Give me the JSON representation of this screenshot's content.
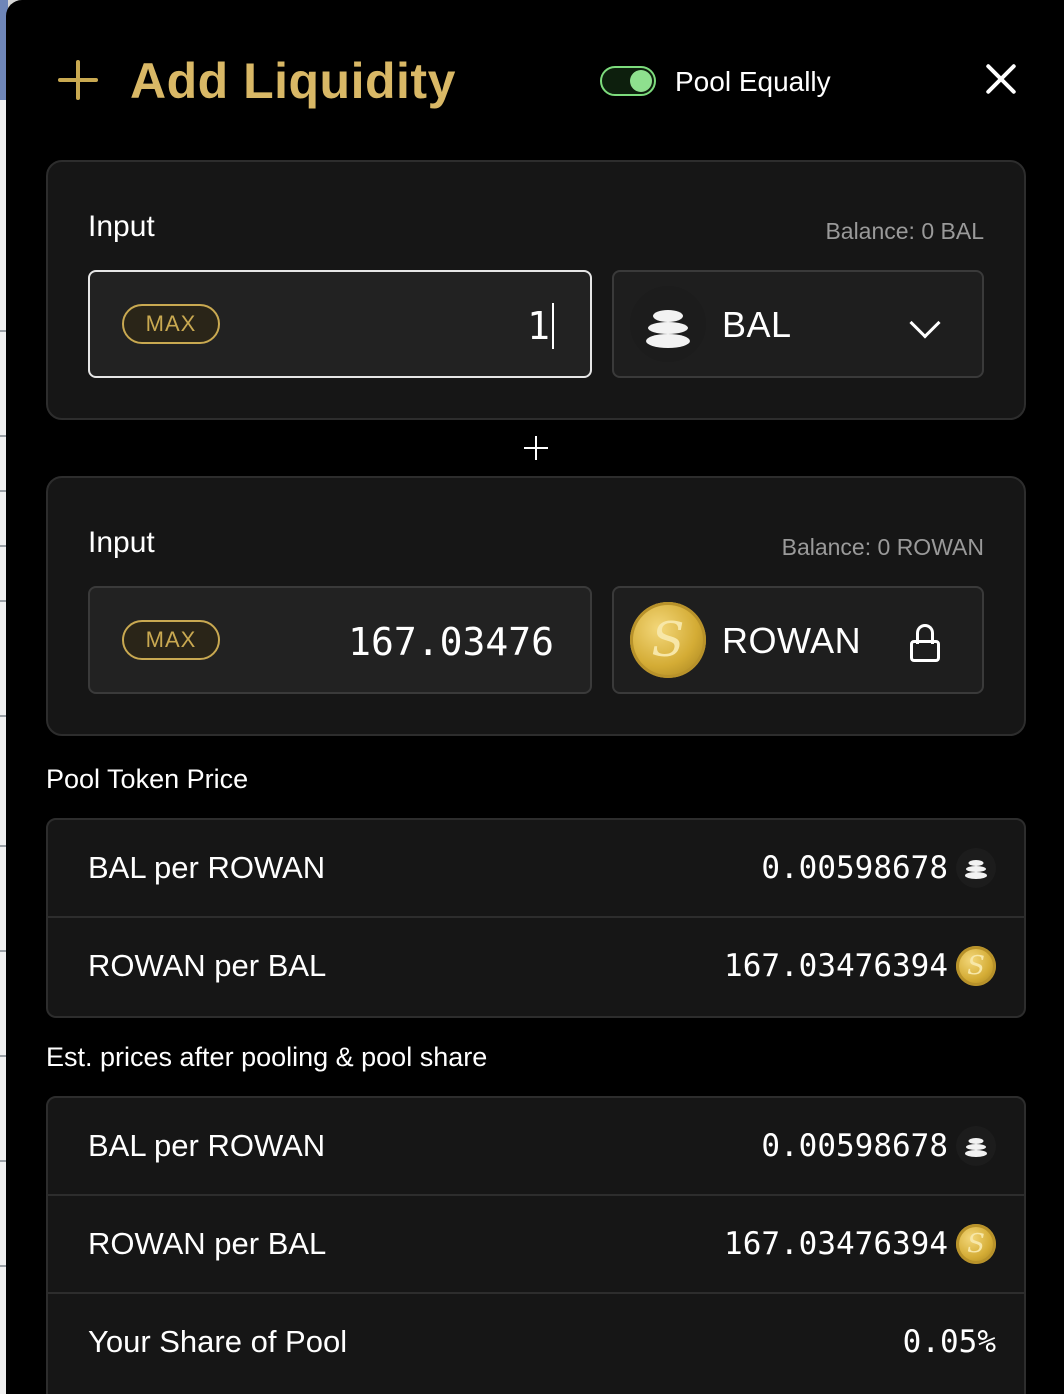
{
  "header": {
    "title": "Add Liquidity",
    "toggle_label": "Pool Equally",
    "toggle_on": true
  },
  "inputs": [
    {
      "label": "Input",
      "balance": "Balance: 0 BAL",
      "max_label": "MAX",
      "amount": "1",
      "token": "BAL",
      "token_icon": "balancer-token-icon",
      "selector_icon": "chevron-down-icon"
    },
    {
      "label": "Input",
      "balance": "Balance: 0 ROWAN",
      "max_label": "MAX",
      "amount": "167.03476",
      "token": "ROWAN",
      "token_icon": "rowan-token-icon",
      "selector_icon": "lock-icon"
    }
  ],
  "pool_token_price": {
    "title": "Pool Token Price",
    "rows": [
      {
        "label": "BAL per ROWAN",
        "value": "0.00598678",
        "icon": "balancer-token-icon"
      },
      {
        "label": "ROWAN per BAL",
        "value": "167.03476394",
        "icon": "rowan-token-icon"
      }
    ]
  },
  "est_prices": {
    "title": "Est. prices after pooling & pool share",
    "rows": [
      {
        "label": "BAL per ROWAN",
        "value": "0.00598678",
        "icon": "balancer-token-icon"
      },
      {
        "label": "ROWAN per BAL",
        "value": "167.03476394",
        "icon": "rowan-token-icon"
      },
      {
        "label": "Your Share of Pool",
        "value": "0.05%"
      }
    ]
  },
  "colors": {
    "accent_gold": "#d9b866",
    "toggle_green": "#8ee08e",
    "panel_bg": "#161616",
    "modal_bg": "#000000"
  }
}
